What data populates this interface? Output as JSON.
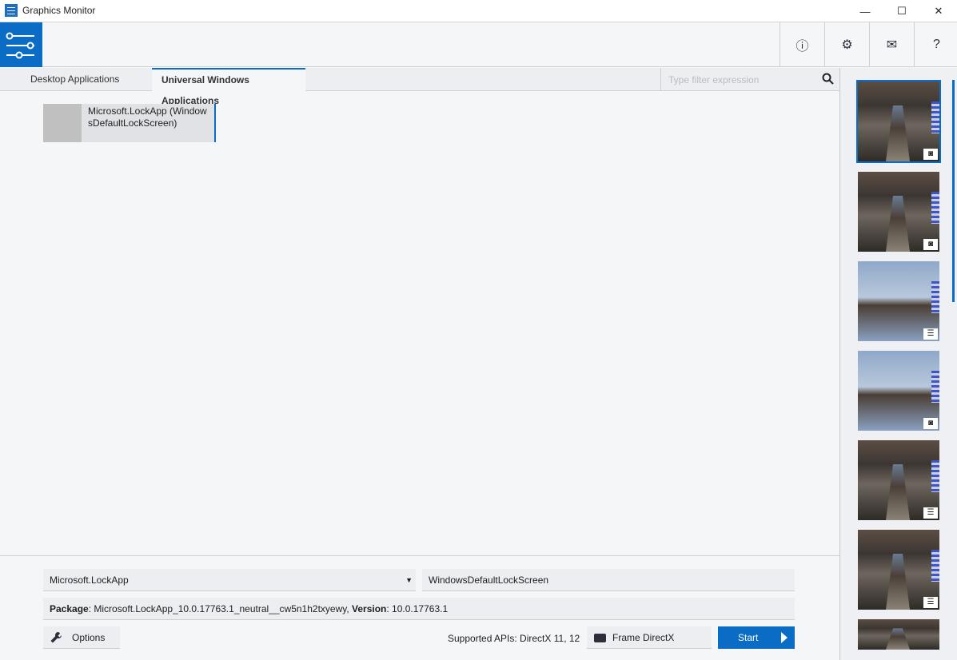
{
  "window": {
    "title": "Graphics Monitor",
    "minimize": "—",
    "maximize": "☐",
    "close": "✕"
  },
  "toolbar": {
    "feedback_icon": "ⓘ",
    "settings_icon": "⚙",
    "mail_icon": "✉",
    "help_label": "?"
  },
  "tabs": [
    {
      "label": "Desktop Applications",
      "active": false
    },
    {
      "label": "Universal Windows Applications",
      "active": true
    }
  ],
  "filter": {
    "placeholder": "Type filter expression"
  },
  "apps": [
    {
      "label": "Microsoft.LockApp (WindowsDefaultLockScreen)"
    }
  ],
  "bottom": {
    "package_select": "Microsoft.LockApp",
    "app_field": "WindowsDefaultLockScreen",
    "package_label": "Package",
    "package_value": ": Microsoft.LockApp_10.0.17763.1_neutral__cw5n1h2txyewy, ",
    "version_label": "Version",
    "version_value": ": 10.0.17763.1",
    "options_label": "Options",
    "supported_apis": "Supported APIs: DirectX 11, 12",
    "frame_label": "Frame DirectX",
    "start_label": "Start"
  },
  "captures": [
    {
      "type": "screenshot",
      "scene": "dark",
      "selected": true
    },
    {
      "type": "screenshot",
      "scene": "dark",
      "selected": false
    },
    {
      "type": "trace",
      "scene": "sky",
      "selected": false
    },
    {
      "type": "screenshot",
      "scene": "sky",
      "selected": false
    },
    {
      "type": "trace",
      "scene": "dark",
      "selected": false
    },
    {
      "type": "trace",
      "scene": "dark",
      "selected": false
    },
    {
      "type": "screenshot",
      "scene": "dark",
      "selected": false
    }
  ],
  "colors": {
    "accent": "#0a6cc4"
  }
}
